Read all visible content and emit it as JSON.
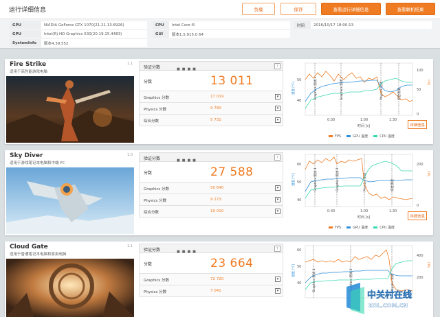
{
  "header": {
    "title": "运行详细信息",
    "btn_load": "负载",
    "btn_save": "保存",
    "btn_view_details": "查看运行详细信息",
    "btn_view_online": "查看联机结果"
  },
  "system_info": {
    "rows": [
      {
        "key": "GPU",
        "value": "NVIDIA GeForce GTX 1070(21.21.13.6926)"
      },
      {
        "key": "GPU",
        "value": "Intel(R) HD Graphics 530(20.19.15.4483)"
      },
      {
        "key": "SystemInfo",
        "value": "版本4.39.552"
      }
    ],
    "cpu_key": "CPU",
    "cpu_value": "Intel Core i5",
    "gui_key": "GUI",
    "gui_value": "版本1.5.915.0 64",
    "time_key": "时间",
    "time_value": "2016/10/17 18:00:13"
  },
  "common": {
    "validation_label": "验证分数",
    "score_label": "分数",
    "details_button": "详细信息",
    "time_axis_label": "时间 [s]",
    "y_left_label": "温度 [°C]",
    "y_right_label": "FPS",
    "question_mark": "?",
    "dropdown_glyph": "▾"
  },
  "tests": [
    {
      "name": "Fire Strike",
      "subtitle": "适用于高性能游戏电脑",
      "version": "1.1",
      "score": "13 011",
      "subscores": [
        {
          "label": "Graphics 分数",
          "value": "17 019"
        },
        {
          "label": "Physics 分数",
          "value": "9 780"
        },
        {
          "label": "综合分数",
          "value": "5 731"
        }
      ],
      "legend": [
        "FPS",
        "GPU 温度",
        "CPU 温度"
      ],
      "x_ticks": [
        "0:30",
        "1:00",
        "1:30"
      ],
      "y_right_ticks": [
        "100",
        "50",
        "0"
      ],
      "y_left_ticks": [
        "50",
        "40"
      ],
      "markers": [
        "Graphics 测试 1",
        "Graphics 测试 2",
        "Physics 测试",
        "综合测试"
      ]
    },
    {
      "name": "Sky Diver",
      "subtitle": "适用于游戏笔记本电脑和中端 PC",
      "version": "1.0",
      "score": "27 588",
      "subscores": [
        {
          "label": "Graphics 分数",
          "value": "50 640"
        },
        {
          "label": "Physics 分数",
          "value": "9 273"
        },
        {
          "label": "综合分数",
          "value": "19 010"
        }
      ],
      "legend": [
        "FPS",
        "GPU 温度",
        "CPU 温度"
      ],
      "x_ticks": [
        "0:30",
        "1:00",
        "1:30"
      ],
      "y_right_ticks": [
        "200",
        "0"
      ],
      "y_left_ticks": [
        "60",
        "50",
        "40"
      ],
      "markers": [
        "Graphics 测试 1",
        "Graphics 测试 2",
        "Physics 测试",
        "综合测试"
      ]
    },
    {
      "name": "Cloud Gate",
      "subtitle": "适用于普通笔记本电脑和家用电脑",
      "version": "1.1",
      "score": "23 664",
      "subscores": [
        {
          "label": "Graphics 分数",
          "value": "72 720"
        },
        {
          "label": "Physics 分数",
          "value": "7 041"
        }
      ],
      "legend": [],
      "x_ticks": [],
      "y_right_ticks": [
        "400",
        "200"
      ],
      "y_left_ticks": [
        "60",
        "50",
        "40"
      ],
      "markers": [
        "Graphics 测试 1",
        "Graphics 测试 2",
        "Physics 测试"
      ]
    }
  ],
  "colors": {
    "accent": "#ef7b22",
    "fps": "#ef7b22",
    "gpu_temp": "#2f8fd8",
    "cpu_temp": "#38d9b0"
  },
  "watermark": {
    "cn": "中关村在线",
    "en": "ZOL.COM.CN"
  }
}
